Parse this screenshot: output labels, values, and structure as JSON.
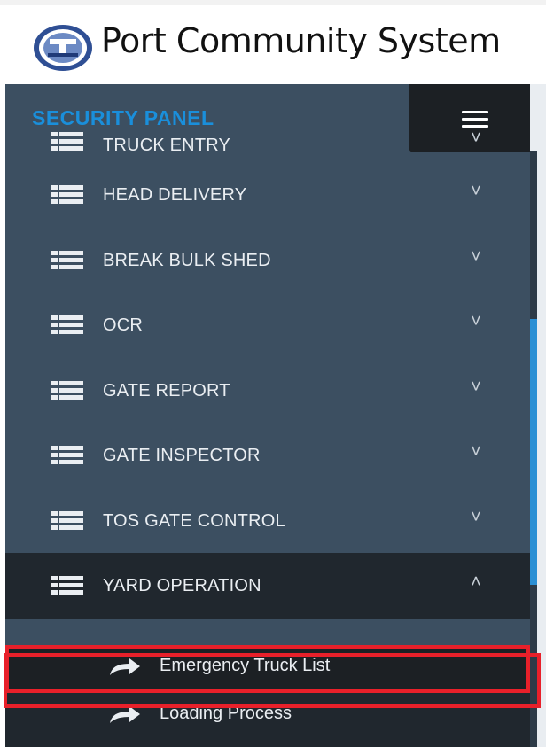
{
  "header": {
    "title": "Port Community System",
    "logo": "port-logo"
  },
  "sidebar": {
    "panel_title": "SECURITY PANEL",
    "toggle_icon": "hamburger-menu-icon",
    "items": [
      {
        "label": "TRUCK ENTRY",
        "icon": "list-icon",
        "chevron": "˅"
      },
      {
        "label": "HEAD DELIVERY",
        "icon": "list-icon",
        "chevron": "˅"
      },
      {
        "label": "BREAK BULK SHED",
        "icon": "list-icon",
        "chevron": "˅"
      },
      {
        "label": "OCR",
        "icon": "list-icon",
        "chevron": "˅"
      },
      {
        "label": "GATE REPORT",
        "icon": "list-icon",
        "chevron": "˅"
      },
      {
        "label": "GATE INSPECTOR",
        "icon": "list-icon",
        "chevron": "˅"
      },
      {
        "label": "TOS GATE CONTROL",
        "icon": "list-icon",
        "chevron": "˅"
      },
      {
        "label": "YARD OPERATION",
        "icon": "list-icon",
        "chevron": "˄"
      }
    ],
    "sub_items": [
      {
        "label": "Emergency Truck List",
        "icon": "share-arrow-icon"
      },
      {
        "label": "Loading Process",
        "icon": "share-arrow-icon"
      }
    ]
  },
  "colors": {
    "sidebar_bg": "#3c4f61",
    "active_bg": "#20272e",
    "accent": "#1a8fdb",
    "highlight": "#e8202a"
  }
}
